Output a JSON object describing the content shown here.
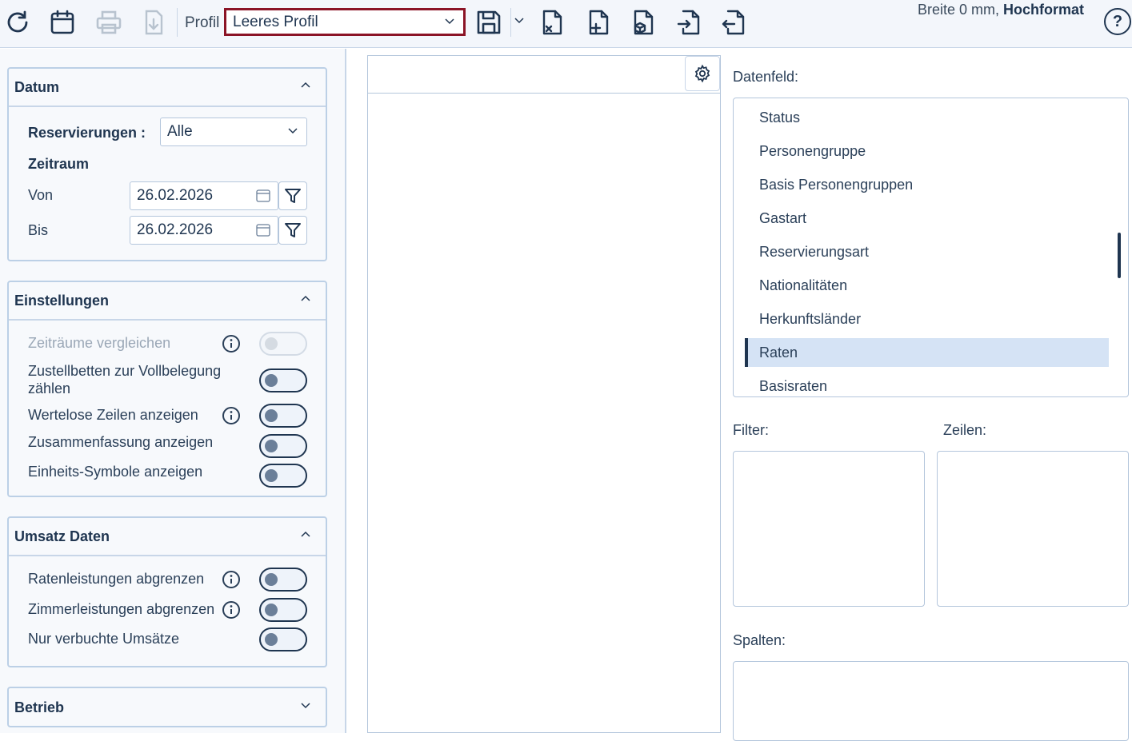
{
  "toolbar": {
    "profile_label": "Profil",
    "profile_value": "Leeres Profil",
    "format_prefix": "Breite 0 mm, ",
    "format_orientation": "Hochformat",
    "help_label": "?"
  },
  "datum": {
    "title": "Datum",
    "reservierungen_label": "Reservierungen :",
    "reservierungen_value": "Alle",
    "zeitraum_label": "Zeitraum",
    "von_label": "Von",
    "von_value": "26.02.2026",
    "bis_label": "Bis",
    "bis_value": "26.02.2026"
  },
  "einstellungen": {
    "title": "Einstellungen",
    "options": [
      {
        "label": "Zeiträume vergleichen",
        "enabled": false,
        "on": false
      },
      {
        "label": "Zustellbetten zur Vollbelegung zählen",
        "enabled": true,
        "on": false
      },
      {
        "label": "Wertelose Zeilen anzeigen",
        "enabled": true,
        "on": false
      },
      {
        "label": "Zusammenfassung anzeigen",
        "enabled": true,
        "on": false
      },
      {
        "label": "Einheits-Symbole anzeigen",
        "enabled": true,
        "on": false
      }
    ]
  },
  "umsatz": {
    "title": "Umsatz Daten",
    "options": [
      {
        "label": "Ratenleistungen abgrenzen",
        "on": false
      },
      {
        "label": "Zimmerleistungen abgrenzen",
        "on": false
      },
      {
        "label": "Nur verbuchte Umsätze",
        "on": false
      }
    ]
  },
  "betrieb": {
    "title": "Betrieb"
  },
  "right": {
    "datenfeld_label": "Datenfeld:",
    "fields": [
      "Status",
      "Personengruppe",
      "Basis Personengruppen",
      "Gastart",
      "Reservierungsart",
      "Nationalitäten",
      "Herkunftsländer",
      "Raten",
      "Basisraten"
    ],
    "selected_field": "Raten",
    "filter_label": "Filter:",
    "zeilen_label": "Zeilen:",
    "spalten_label": "Spalten:"
  },
  "colors": {
    "accent": "#1f3550",
    "profile_border": "#8b1426",
    "selected_bg": "#d5e3f5",
    "border": "#b4c6dc"
  }
}
